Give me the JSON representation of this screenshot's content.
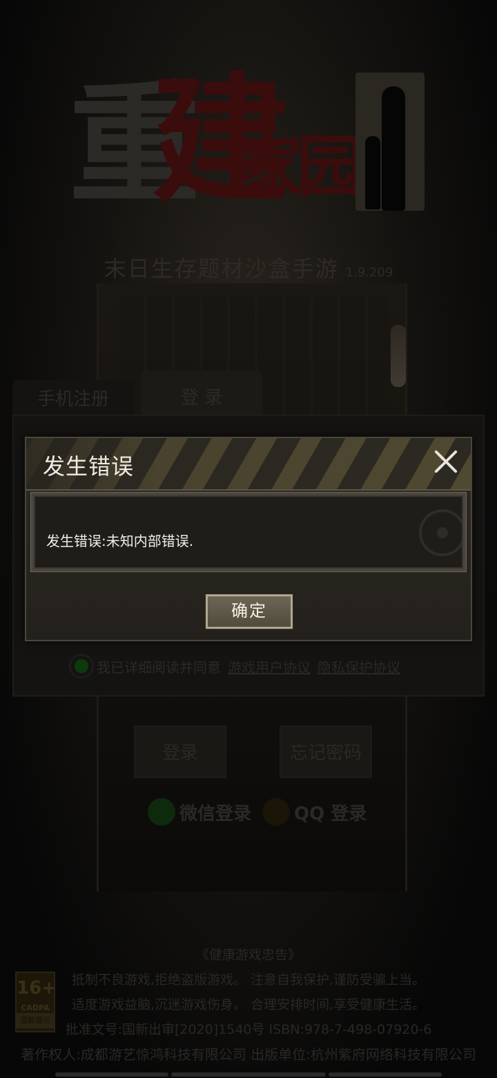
{
  "game": {
    "logo_chars": [
      "重",
      "建",
      "家园"
    ],
    "subtitle": "末日生存题材沙盒手游",
    "version": "1.9.209"
  },
  "login": {
    "tab_register": "手机注册",
    "tab_login": "登 录",
    "agree_text": "我已详细阅读并同意",
    "agree_link_user": "游戏用户协议",
    "agree_link_privacy": "隐私保护协议",
    "login_button": "登录",
    "forgot_button": "忘记密码",
    "wechat_login": "微信登录",
    "qq_login": "QQ 登录"
  },
  "footer": {
    "title": "《健康游戏忠告》",
    "line1": "抵制不良游戏,拒绝盗版游戏。 注意自我保护,谨防受骗上当。",
    "line2": "适度游戏益脑,沉迷游戏伤身。 合理安排时间,享受健康生活。",
    "line3": "批准文号:国新出审[2020]1540号      ISBN:978-7-498-07920-6",
    "line4": "著作权人:成都游艺惊鸿科技有限公司 出版单位:杭州紫府网络科技有限公司",
    "age_badge": {
      "age": "16+",
      "org": "CADPA",
      "tip": "适龄提示"
    }
  },
  "dialog": {
    "title": "发生错误",
    "message": "发生错误:未知内部错误.",
    "ok_label": "确定"
  },
  "colors": {
    "overlay": "#050505",
    "dialog_bg": "#2d2a24",
    "stripe": "#5a5236",
    "button_border": "#b0a88f"
  }
}
